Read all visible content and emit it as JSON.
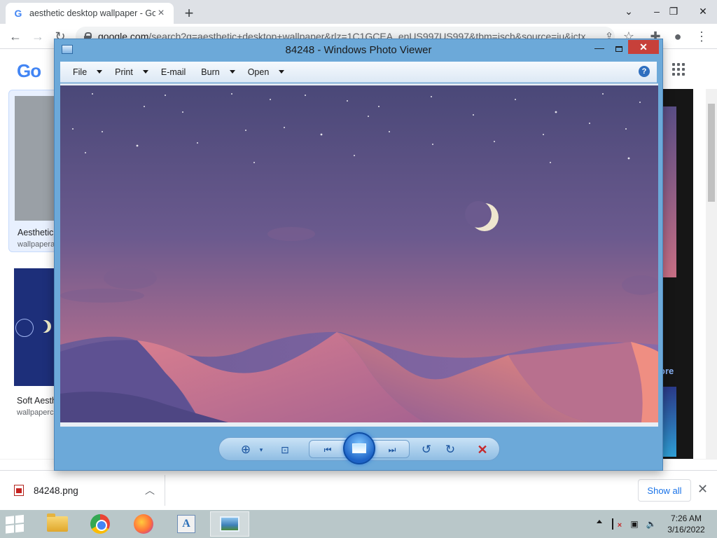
{
  "browser": {
    "tab_title": "aesthetic desktop wallpaper - Go",
    "tab_favicon": "G",
    "new_tab": "+",
    "url_host": "google.com",
    "url_path": "/search?q=aesthetic+desktop+wallpaper&rlz=1C1GCEA_enUS997US997&tbm=isch&source=iu&ictx"
  },
  "google": {
    "logo": "Go",
    "result1_title": "Aesthetic",
    "result1_source": "wallpapera",
    "result2_title": "Soft Aesth",
    "result2_source": "wallpaperc",
    "right_more": "ore"
  },
  "photo_viewer": {
    "title": "84248 - Windows Photo Viewer",
    "menus": [
      "File",
      "Print",
      "E-mail",
      "Burn",
      "Open"
    ],
    "help": "?"
  },
  "downloads": {
    "file_name": "84248.png",
    "show_all": "Show all"
  },
  "taskbar": {
    "time": "7:26 AM",
    "date": "3/16/2022",
    "access_glyph": "A"
  },
  "colors": {
    "photo_viewer_frame": "#6ca9d9",
    "close_button": "#c7403a",
    "link_blue": "#1a73e8",
    "taskbar": "#b9c7c9"
  }
}
